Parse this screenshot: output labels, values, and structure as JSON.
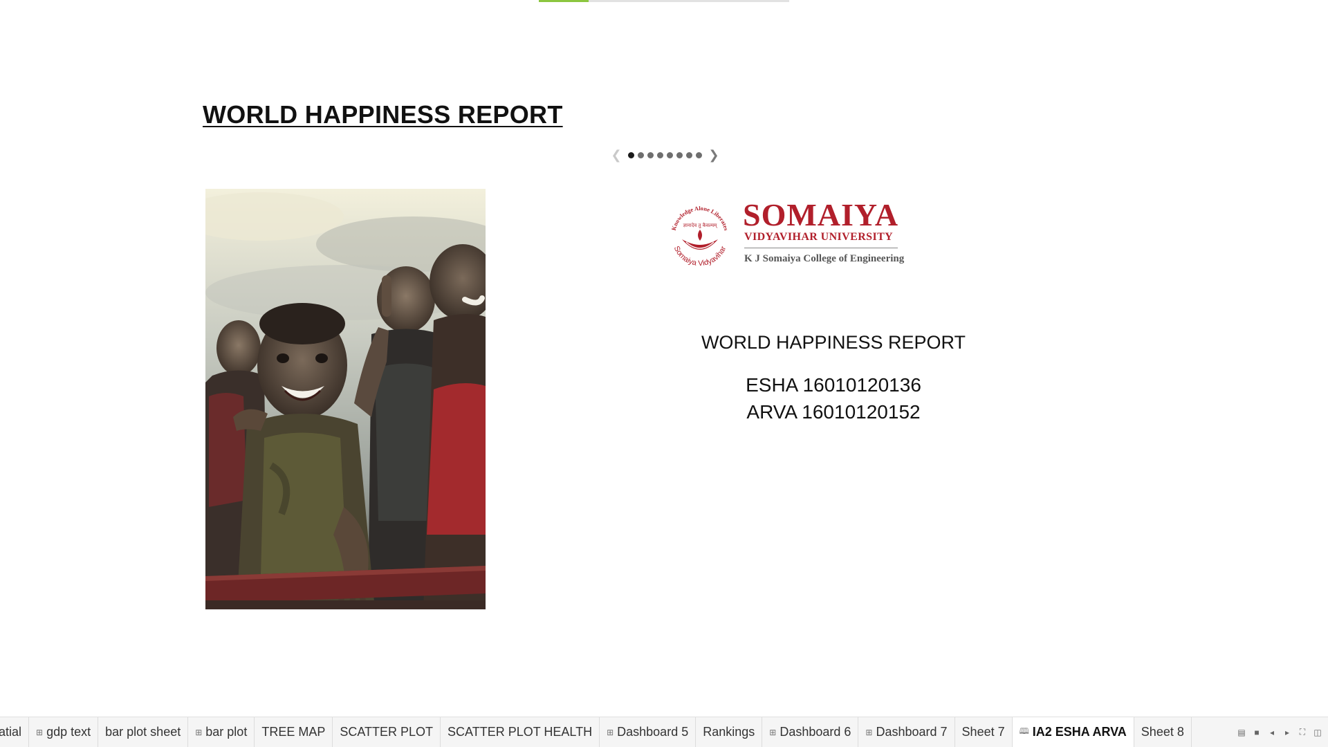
{
  "story": {
    "title": "WORLD HAPPINESS REPORT",
    "current_point": 1,
    "point_count": 8,
    "progress_fraction": 0.2
  },
  "nav": {
    "prev_icon": "chevron-left-icon",
    "next_icon": "chevron-right-icon"
  },
  "photo": {
    "subject": "smiling-children-photo"
  },
  "logo": {
    "name": "SOMAIYA",
    "subtitle": "VIDYAVIHAR UNIVERSITY",
    "college": "K J Somaiya College of Engineering",
    "motto": "Knowledge Alone Liberates",
    "motto_devanagari": "ज्ञानादेव तु कैवल्यम्",
    "emblem_text": "Somaiya Vidyavihar",
    "brand_color": "#b11f2b"
  },
  "info": {
    "title": "WORLD HAPPINESS REPORT",
    "line1": "ESHA 16010120136",
    "line2": "ARVA 16010120152"
  },
  "tabs": [
    {
      "label": "atial",
      "icon": "",
      "active": false
    },
    {
      "label": "gdp text",
      "icon": "⊞",
      "active": false
    },
    {
      "label": "bar plot sheet",
      "icon": "",
      "active": false
    },
    {
      "label": "bar plot",
      "icon": "⊞",
      "active": false
    },
    {
      "label": "TREE MAP",
      "icon": "",
      "active": false
    },
    {
      "label": "SCATTER PLOT",
      "icon": "",
      "active": false
    },
    {
      "label": "SCATTER PLOT HEALTH",
      "icon": "",
      "active": false
    },
    {
      "label": "Dashboard 5",
      "icon": "⊞",
      "active": false
    },
    {
      "label": "Rankings",
      "icon": "",
      "active": false
    },
    {
      "label": "Dashboard 6",
      "icon": "⊞",
      "active": false
    },
    {
      "label": "Dashboard 7",
      "icon": "⊞",
      "active": false
    },
    {
      "label": "Sheet 7",
      "icon": "",
      "active": false
    },
    {
      "label": "IA2 ESHA ARVA",
      "icon": "🕮",
      "active": true
    },
    {
      "label": "Sheet 8",
      "icon": "",
      "active": false
    }
  ],
  "tab_controls": [
    "show-filmstrip-icon",
    "show-tabs-icon",
    "scroll-left-icon",
    "scroll-right-icon",
    "fullscreen-icon",
    "presentation-icon"
  ]
}
